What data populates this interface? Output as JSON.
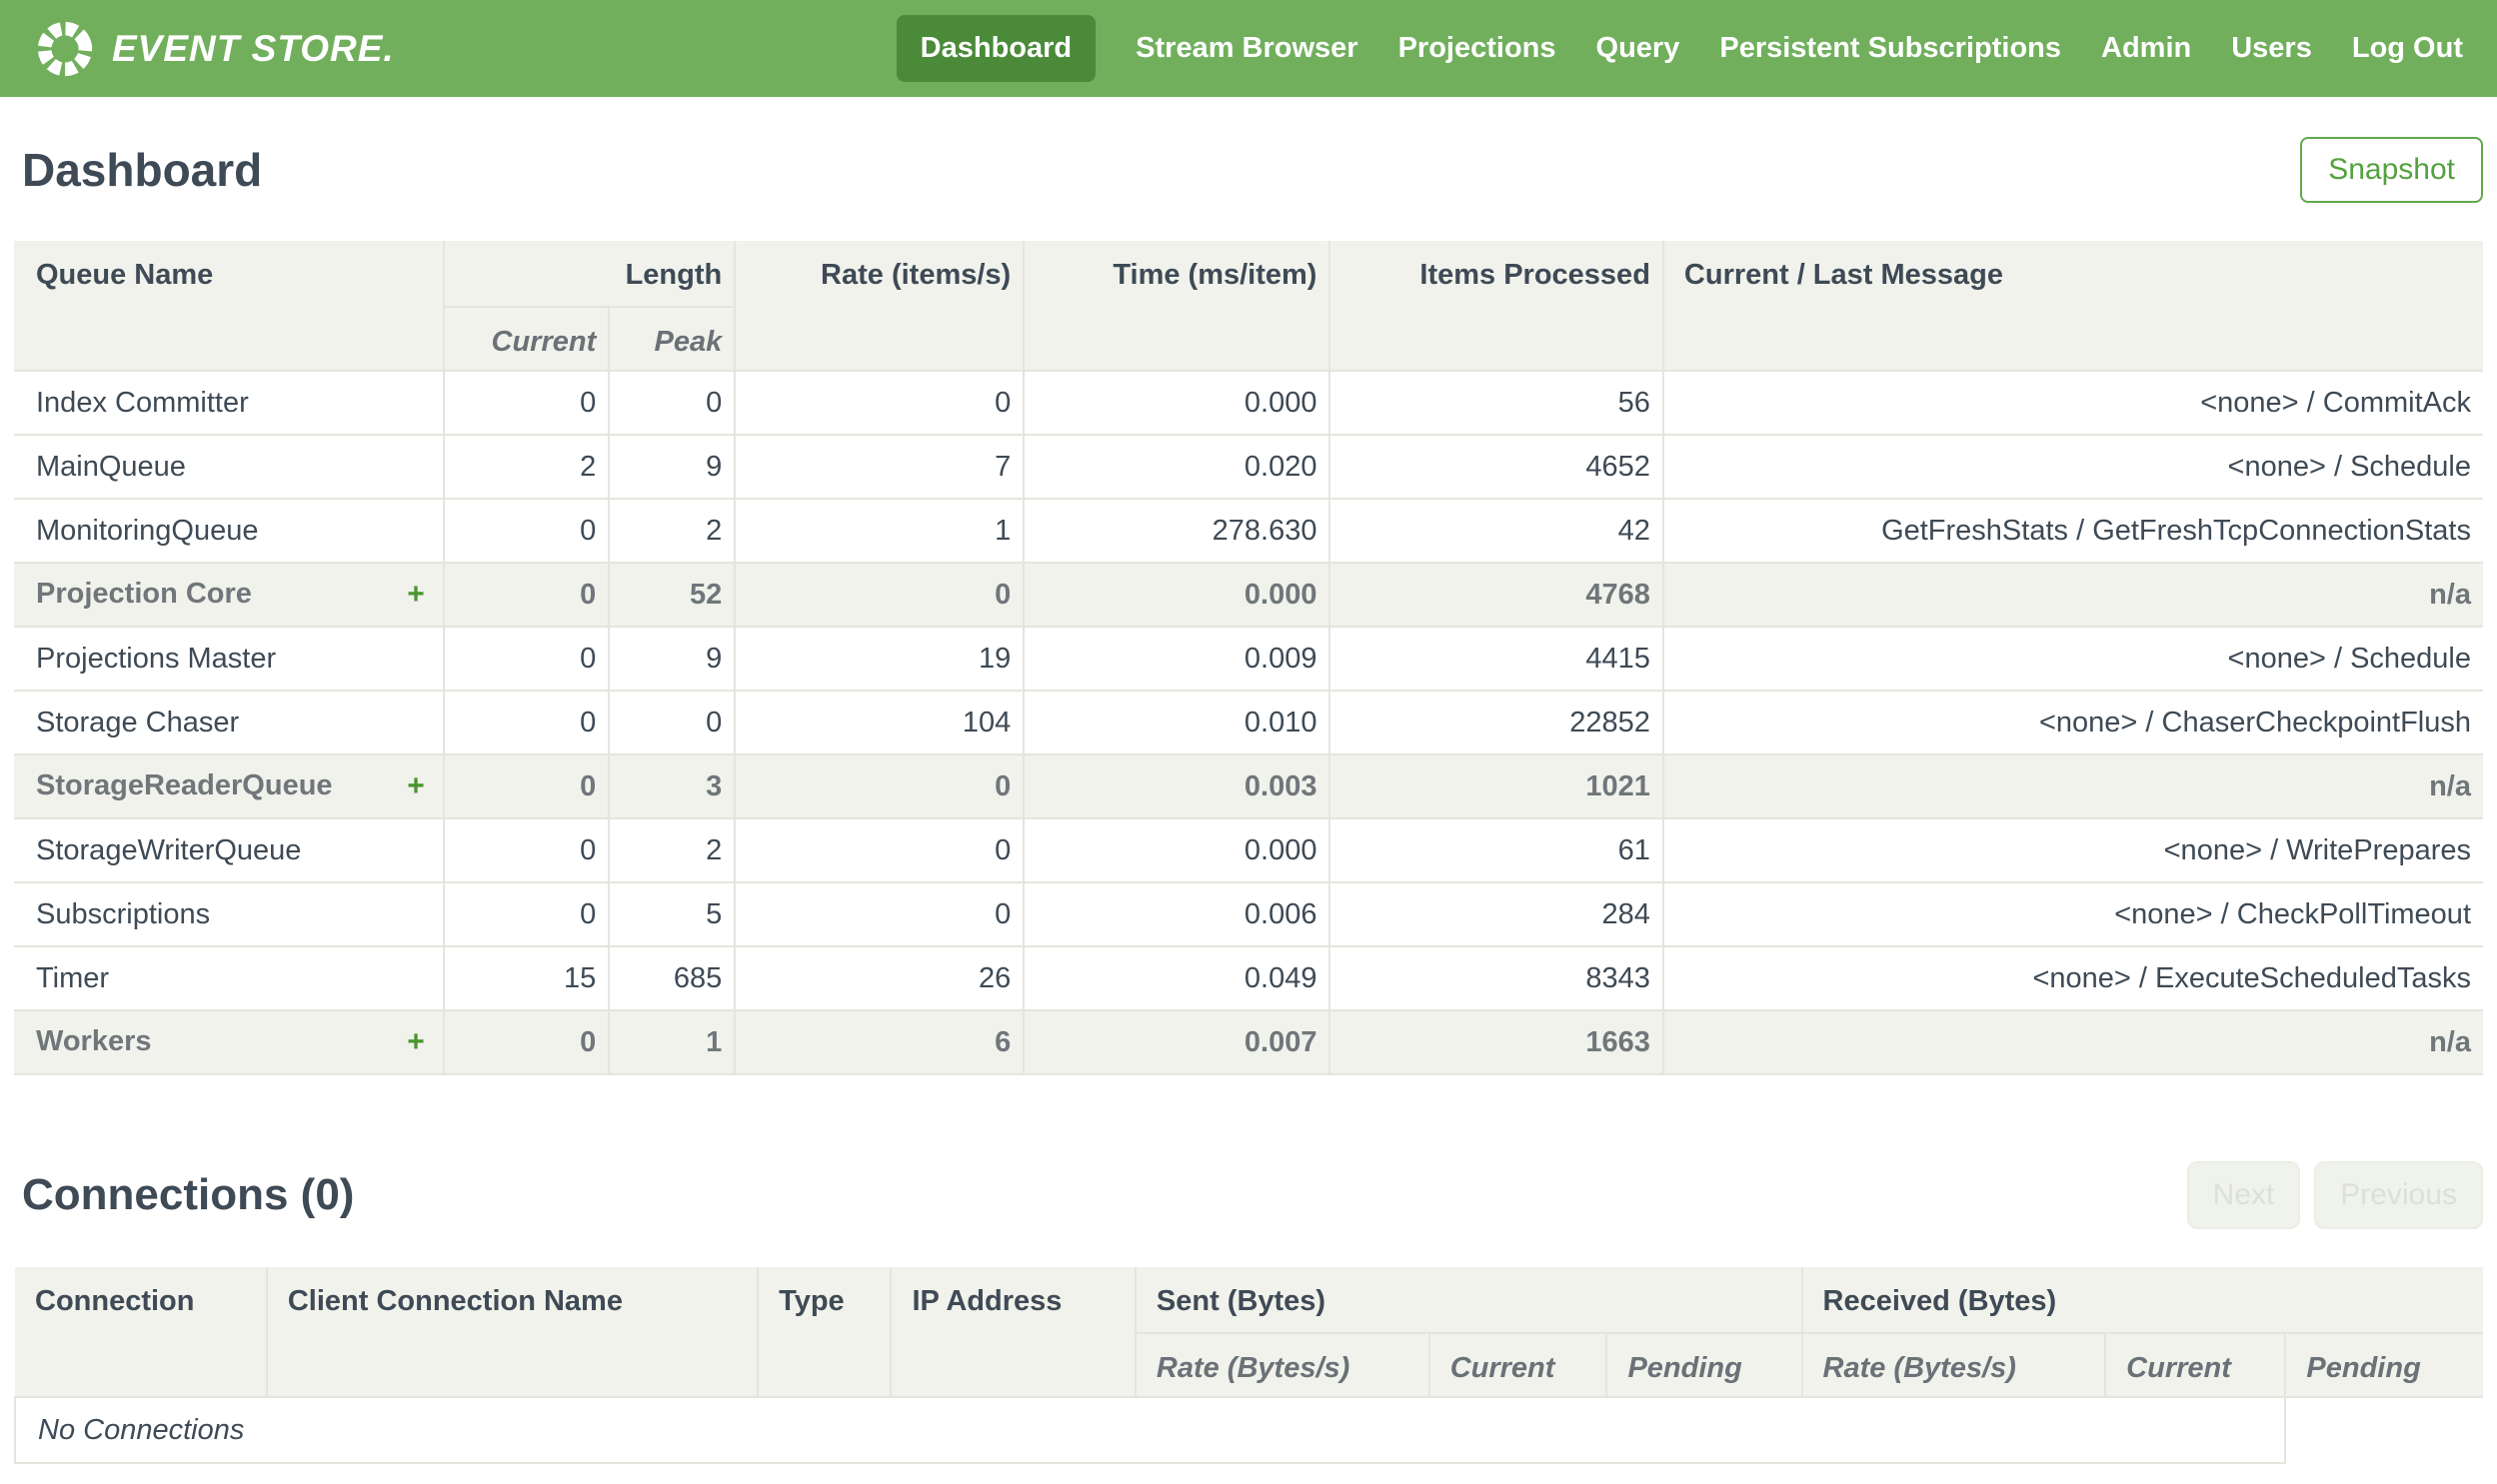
{
  "colors": {
    "brand_green": "#71AF5D",
    "active_nav_green": "#4A8A39",
    "accent_green": "#53A23E",
    "plus_green": "#48962F",
    "header_bg": "#F0F2EB",
    "border": "#E3E6DD",
    "text_dark": "#3E4A55",
    "text_gray": "#70767A",
    "disabled_text": "#DDE1D5"
  },
  "nav": {
    "brand": "EVENT STORE.",
    "items": [
      {
        "label": "Dashboard",
        "active": true
      },
      {
        "label": "Stream Browser",
        "active": false
      },
      {
        "label": "Projections",
        "active": false
      },
      {
        "label": "Query",
        "active": false
      },
      {
        "label": "Persistent Subscriptions",
        "active": false
      },
      {
        "label": "Admin",
        "active": false
      },
      {
        "label": "Users",
        "active": false
      },
      {
        "label": "Log Out",
        "active": false
      }
    ]
  },
  "page": {
    "title": "Dashboard"
  },
  "toolbar": {
    "snapshot_label": "Snapshot"
  },
  "queues": {
    "headers": {
      "queue_name": "Queue Name",
      "length": "Length",
      "current": "Current",
      "peak": "Peak",
      "rate": "Rate (items/s)",
      "time": "Time (ms/item)",
      "items_processed": "Items Processed",
      "message": "Current / Last Message"
    },
    "expand_symbol": "+",
    "rows": [
      {
        "name": "Index Committer",
        "group": false,
        "expandable": false,
        "current": "0",
        "peak": "0",
        "rate": "0",
        "time": "0.000",
        "items": "56",
        "message": "<none> / CommitAck"
      },
      {
        "name": "MainQueue",
        "group": false,
        "expandable": false,
        "current": "2",
        "peak": "9",
        "rate": "7",
        "time": "0.020",
        "items": "4652",
        "message": "<none> / Schedule"
      },
      {
        "name": "MonitoringQueue",
        "group": false,
        "expandable": false,
        "current": "0",
        "peak": "2",
        "rate": "1",
        "time": "278.630",
        "items": "42",
        "message": "GetFreshStats / GetFreshTcpConnectionStats"
      },
      {
        "name": "Projection Core",
        "group": true,
        "expandable": true,
        "current": "0",
        "peak": "52",
        "rate": "0",
        "time": "0.000",
        "items": "4768",
        "message": "n/a"
      },
      {
        "name": "Projections Master",
        "group": false,
        "expandable": false,
        "current": "0",
        "peak": "9",
        "rate": "19",
        "time": "0.009",
        "items": "4415",
        "message": "<none> / Schedule"
      },
      {
        "name": "Storage Chaser",
        "group": false,
        "expandable": false,
        "current": "0",
        "peak": "0",
        "rate": "104",
        "time": "0.010",
        "items": "22852",
        "message": "<none> / ChaserCheckpointFlush"
      },
      {
        "name": "StorageReaderQueue",
        "group": true,
        "expandable": true,
        "current": "0",
        "peak": "3",
        "rate": "0",
        "time": "0.003",
        "items": "1021",
        "message": "n/a"
      },
      {
        "name": "StorageWriterQueue",
        "group": false,
        "expandable": false,
        "current": "0",
        "peak": "2",
        "rate": "0",
        "time": "0.000",
        "items": "61",
        "message": "<none> / WritePrepares"
      },
      {
        "name": "Subscriptions",
        "group": false,
        "expandable": false,
        "current": "0",
        "peak": "5",
        "rate": "0",
        "time": "0.006",
        "items": "284",
        "message": "<none> / CheckPollTimeout"
      },
      {
        "name": "Timer",
        "group": false,
        "expandable": false,
        "current": "15",
        "peak": "685",
        "rate": "26",
        "time": "0.049",
        "items": "8343",
        "message": "<none> / ExecuteScheduledTasks"
      },
      {
        "name": "Workers",
        "group": true,
        "expandable": true,
        "current": "0",
        "peak": "1",
        "rate": "6",
        "time": "0.007",
        "items": "1663",
        "message": "n/a"
      }
    ]
  },
  "connections": {
    "title": "Connections (0)",
    "next_label": "Next",
    "previous_label": "Previous",
    "headers": {
      "connection": "Connection",
      "client_name": "Client Connection Name",
      "type": "Type",
      "ip": "IP Address",
      "sent": "Sent (Bytes)",
      "received": "Received (Bytes)",
      "rate": "Rate (Bytes/s)",
      "current": "Current",
      "pending": "Pending"
    },
    "empty_text": "No Connections"
  }
}
